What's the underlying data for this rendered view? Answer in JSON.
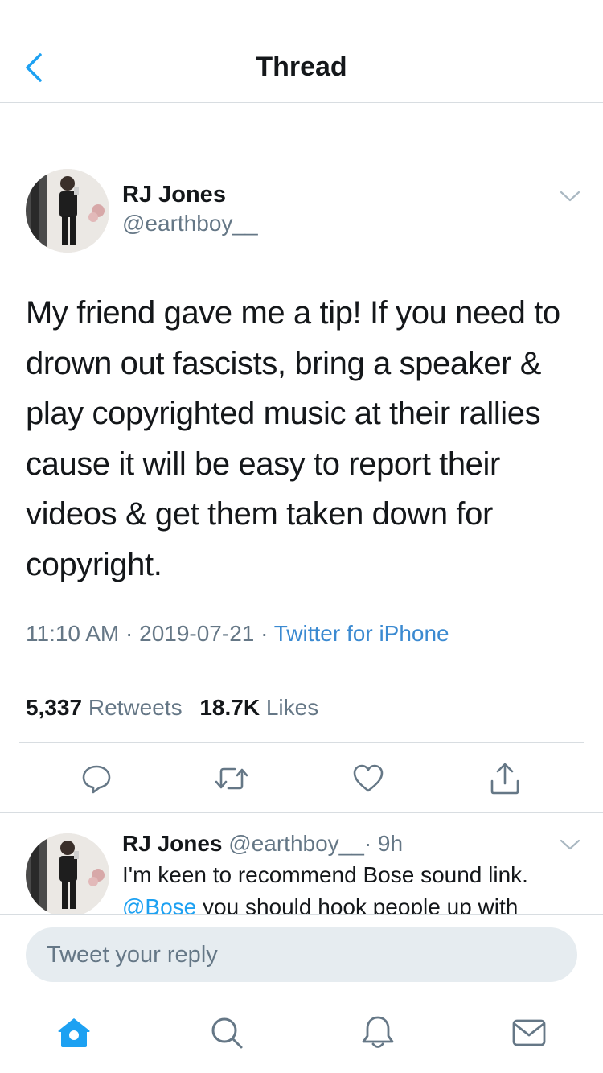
{
  "header": {
    "title": "Thread",
    "back_icon": "chevron-left-icon"
  },
  "tweet": {
    "author_name": "RJ Jones",
    "author_handle": "@earthboy__",
    "text": "My friend gave me a tip! If you need to drown out fascists, bring a speaker & play copyrighted music at their rallies cause it will be easy to report their videos & get them taken down for copyright.",
    "time": "11:10 AM",
    "date": "2019-07-21",
    "separator": "·",
    "source": "Twitter for iPhone",
    "retweets_count": "5,337",
    "retweets_label": "Retweets",
    "likes_count": "18.7K",
    "likes_label": "Likes",
    "actions": [
      "reply-icon",
      "retweet-icon",
      "heart-icon",
      "share-icon"
    ]
  },
  "reply": {
    "author_name": "RJ Jones",
    "author_handle": "@earthboy__",
    "age": "· 9h",
    "line1": "I'm keen to recommend Bose sound link.",
    "mention": "@Bose",
    "line2_rest": " you should hook people up with"
  },
  "composer": {
    "placeholder": "Tweet your reply"
  },
  "tabbar": {
    "items": [
      "home-icon",
      "search-icon",
      "notifications-icon",
      "messages-icon"
    ],
    "active": "home-icon"
  },
  "colors": {
    "accent": "#1da1f2",
    "text_primary": "#14171a",
    "text_secondary": "#657786",
    "divider": "#d8dde1",
    "input_bg": "#e6ecf0"
  }
}
